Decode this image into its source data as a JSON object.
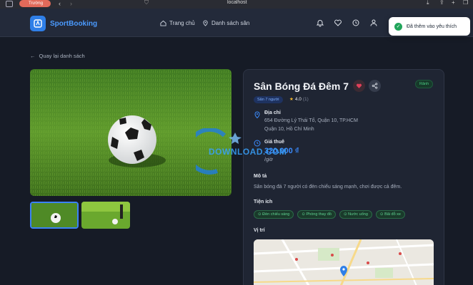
{
  "browser": {
    "profile_label": "Trường",
    "url": "localhost"
  },
  "header": {
    "brand": "SportBooking",
    "nav": [
      {
        "label": "Trang chủ"
      },
      {
        "label": "Danh sách sân"
      }
    ]
  },
  "toast": {
    "message": "Đã thêm vào yêu thích"
  },
  "back_link": "Quay lại danh sách",
  "field": {
    "name": "Sân Bóng Đá Đêm 7",
    "status": "Rảnh",
    "type": "Sân 7 người",
    "rating": "4.0",
    "rating_count": "(1)",
    "address_label": "Địa chỉ",
    "address_line1": "654 Đường Lý Thái Tổ, Quận 10, TP.HCM",
    "address_line2": "Quận 10, Hồ Chí Minh",
    "price_label": "Giá thuê",
    "price": "320.000 ₫",
    "price_unit": "/giờ",
    "description_label": "Mô tả",
    "description": "Sân bóng đá 7 người có đèn chiếu sáng mạnh, chơi được cả đêm.",
    "amenities_label": "Tiện ích",
    "amenities": [
      "Đèn chiếu sáng",
      "Phòng thay đồ",
      "Nước uống",
      "Bãi đỗ xe"
    ],
    "location_label": "Vị trí"
  },
  "watermark": "DOWNLOAD.COM",
  "colors": {
    "accent": "#3b82f6",
    "favorite": "#e0405a",
    "success": "#22a55b"
  }
}
